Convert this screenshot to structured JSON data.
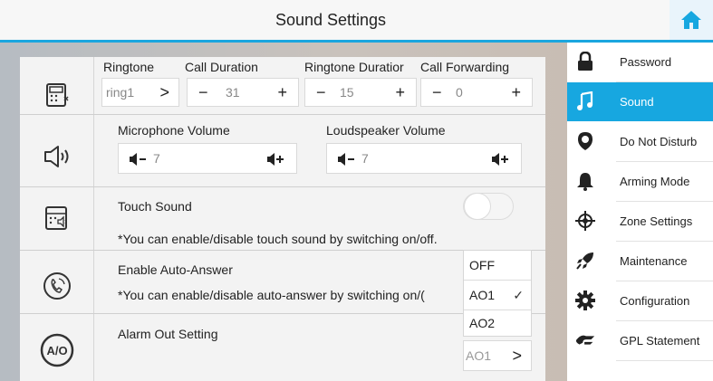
{
  "header": {
    "title": "Sound Settings",
    "home_icon": "home-icon",
    "accent": "#1aa6df"
  },
  "ringtone_row": {
    "ringtone": {
      "label": "Ringtone",
      "value": "ring1",
      "chevron": ">"
    },
    "call_duration": {
      "label": "Call Duration",
      "minus": "−",
      "value": "31",
      "plus": "+"
    },
    "ringtone_duration": {
      "label": "Ringtone Duratior",
      "minus": "−",
      "value": "15",
      "plus": "+"
    },
    "call_forwarding": {
      "label": "Call Forwarding",
      "minus": "−",
      "value": "0",
      "plus": "+"
    }
  },
  "volume_row": {
    "microphone": {
      "label": "Microphone Volume",
      "minus": "◀−",
      "value": "7"
    },
    "loudspeaker": {
      "label": "Loudspeaker Volume",
      "minus": "◀−",
      "value": "7"
    }
  },
  "touch_row": {
    "label": "Touch Sound",
    "note": "*You can enable/disable touch sound by switching on/off.",
    "toggle_on": false
  },
  "auto_answer_row": {
    "label": "Enable Auto-Answer",
    "note": "*You can enable/disable auto-answer by switching on/("
  },
  "alarm_row": {
    "label": "Alarm Out Setting",
    "value": "AO1",
    "chevron": ">"
  },
  "dropdown": {
    "options": [
      "OFF",
      "AO1",
      "AO2"
    ],
    "selected": "AO1",
    "check": "✓"
  },
  "sidebar": {
    "items": [
      {
        "label": "Password",
        "icon": "lock-icon",
        "active": false
      },
      {
        "label": "Sound",
        "icon": "music-note-icon",
        "active": true
      },
      {
        "label": "Do Not Disturb",
        "icon": "do-not-disturb-icon",
        "active": false
      },
      {
        "label": "Arming Mode",
        "icon": "bell-icon",
        "active": false
      },
      {
        "label": "Zone Settings",
        "icon": "crosshair-icon",
        "active": false
      },
      {
        "label": "Maintenance",
        "icon": "rocket-icon",
        "active": false
      },
      {
        "label": "Configuration",
        "icon": "gear-icon",
        "active": false
      },
      {
        "label": "GPL Statement",
        "icon": "gpl-icon",
        "active": false
      }
    ],
    "active_color": "#17a7e0"
  }
}
